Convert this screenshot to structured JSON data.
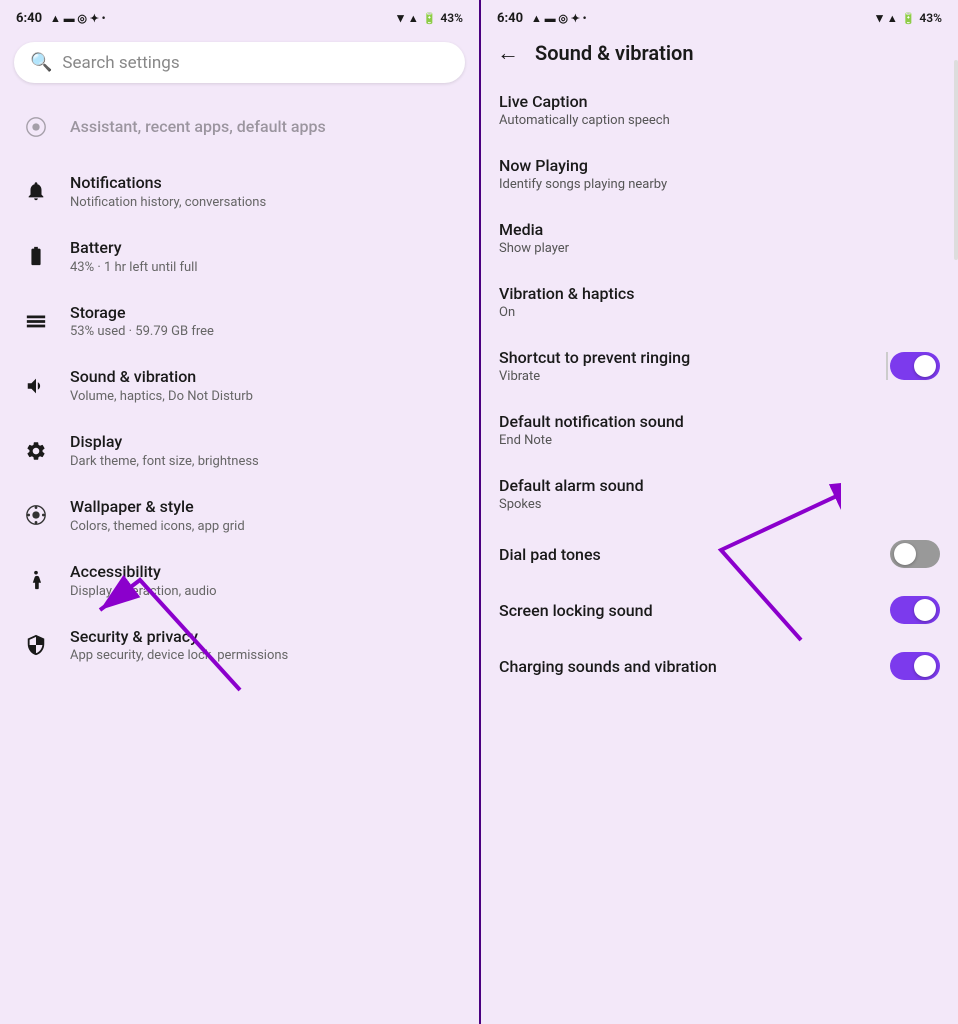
{
  "left": {
    "statusBar": {
      "time": "6:40",
      "battery": "43%"
    },
    "search": {
      "placeholder": "Search settings"
    },
    "items": [
      {
        "id": "assistant",
        "icon": "◉",
        "title": "Assistant, recent apps, default apps",
        "subtitle": "",
        "faded": true
      },
      {
        "id": "notifications",
        "icon": "🔔",
        "title": "Notifications",
        "subtitle": "Notification history, conversations"
      },
      {
        "id": "battery",
        "icon": "🔋",
        "title": "Battery",
        "subtitle": "43% · 1 hr left until full"
      },
      {
        "id": "storage",
        "icon": "☰",
        "title": "Storage",
        "subtitle": "53% used · 59.79 GB free"
      },
      {
        "id": "sound",
        "icon": "🔊",
        "title": "Sound & vibration",
        "subtitle": "Volume, haptics, Do Not Disturb"
      },
      {
        "id": "display",
        "icon": "⚙",
        "title": "Display",
        "subtitle": "Dark theme, font size, brightness"
      },
      {
        "id": "wallpaper",
        "icon": "🎨",
        "title": "Wallpaper & style",
        "subtitle": "Colors, themed icons, app grid"
      },
      {
        "id": "accessibility",
        "icon": "♿",
        "title": "Accessibility",
        "subtitle": "Display, interaction, audio"
      },
      {
        "id": "security",
        "icon": "🛡",
        "title": "Security & privacy",
        "subtitle": "App security, device lock, permissions"
      }
    ]
  },
  "right": {
    "statusBar": {
      "time": "6:40",
      "battery": "43%"
    },
    "header": {
      "backLabel": "←",
      "title": "Sound & vibration"
    },
    "items": [
      {
        "id": "live-caption",
        "title": "Live Caption",
        "subtitle": "Automatically caption speech",
        "hasToggle": false
      },
      {
        "id": "now-playing",
        "title": "Now Playing",
        "subtitle": "Identify songs playing nearby",
        "hasToggle": false
      },
      {
        "id": "media",
        "title": "Media",
        "subtitle": "Show player",
        "hasToggle": false
      },
      {
        "id": "vibration-haptics",
        "title": "Vibration & haptics",
        "subtitle": "On",
        "hasToggle": false
      },
      {
        "id": "shortcut-prevent-ringing",
        "title": "Shortcut to prevent ringing",
        "subtitle": "Vibrate",
        "hasToggle": true,
        "toggleOn": true,
        "hasDivider": true
      },
      {
        "id": "default-notification-sound",
        "title": "Default notification sound",
        "subtitle": "End Note",
        "hasToggle": false
      },
      {
        "id": "default-alarm-sound",
        "title": "Default alarm sound",
        "subtitle": "Spokes",
        "hasToggle": false
      },
      {
        "id": "dial-pad-tones",
        "title": "Dial pad tones",
        "subtitle": "",
        "hasToggle": true,
        "toggleOn": false
      },
      {
        "id": "screen-locking-sound",
        "title": "Screen locking sound",
        "subtitle": "",
        "hasToggle": true,
        "toggleOn": true
      },
      {
        "id": "charging-sounds-vibration",
        "title": "Charging sounds and vibration",
        "subtitle": "",
        "hasToggle": true,
        "toggleOn": true
      }
    ]
  },
  "arrows": {
    "leftArrow": {
      "description": "Purple arrow pointing to Sound & vibration item"
    },
    "rightArrow": {
      "description": "Purple arrow pointing to Shortcut to prevent ringing toggle"
    }
  }
}
